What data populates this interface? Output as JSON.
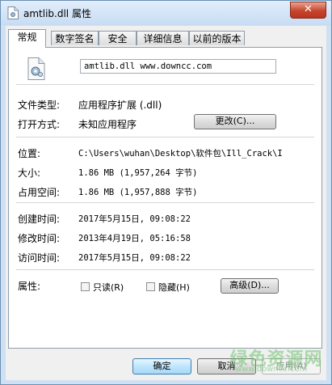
{
  "window": {
    "title": "amtlib.dll 属性",
    "close_label": "✕"
  },
  "tabs": [
    {
      "label": "常规",
      "active": true
    },
    {
      "label": "数字签名",
      "active": false
    },
    {
      "label": "安全",
      "active": false
    },
    {
      "label": "详细信息",
      "active": false
    },
    {
      "label": "以前的版本",
      "active": false
    }
  ],
  "general": {
    "file_name": "amtlib.dll  www.downcc.com",
    "file_type_label": "文件类型:",
    "file_type_value": "应用程序扩展 (.dll)",
    "open_with_label": "打开方式:",
    "open_with_value": "未知应用程序",
    "change_button": "更改(C)...",
    "location_label": "位置:",
    "location_value": "C:\\Users\\wuhan\\Desktop\\软件包\\Ill_Crack\\I",
    "size_label": "大小:",
    "size_value": "1.86 MB (1,957,264 字节)",
    "disk_size_label": "占用空间:",
    "disk_size_value": "1.86 MB (1,957,888 字节)",
    "created_label": "创建时间:",
    "created_value": "2017年5月15日, 09:08:22",
    "modified_label": "修改时间:",
    "modified_value": "2013年4月19日, 05:16:58",
    "accessed_label": "访问时间:",
    "accessed_value": "2017年5月15日, 09:08:22",
    "attributes_label": "属性:",
    "readonly_label": "只读(R)",
    "hidden_label": "隐藏(H)",
    "advanced_button": "高级(D)..."
  },
  "footer": {
    "ok_button": "确定",
    "cancel_button": "取消",
    "apply_button": "应用(A)"
  },
  "watermark": {
    "text": "绿色资源网",
    "sub": "www.downcc.com"
  }
}
